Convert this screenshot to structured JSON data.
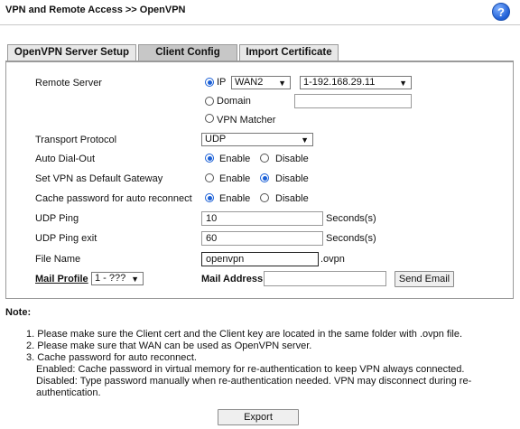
{
  "header": {
    "title": "VPN and Remote Access >> OpenVPN",
    "help_icon": "?"
  },
  "tabs": [
    {
      "label": "OpenVPN Server Setup",
      "active": false
    },
    {
      "label": "Client Config",
      "active": true
    },
    {
      "label": "Import Certificate",
      "active": false
    }
  ],
  "form": {
    "remote_server": {
      "label": "Remote Server",
      "ip_label": "IP",
      "wan_value": "WAN2",
      "ip_value": "1-192.168.29.11",
      "domain_label": "Domain",
      "domain_value": "",
      "vpn_matcher_label": "VPN Matcher"
    },
    "transport_protocol": {
      "label": "Transport Protocol",
      "value": "UDP"
    },
    "auto_dial_out": {
      "label": "Auto Dial-Out",
      "enable": "Enable",
      "disable": "Disable",
      "selected": "Enable"
    },
    "default_gateway": {
      "label": "Set VPN as Default Gateway",
      "enable": "Enable",
      "disable": "Disable",
      "selected": "Disable"
    },
    "cache_password": {
      "label": "Cache password for auto reconnect",
      "enable": "Enable",
      "disable": "Disable",
      "selected": "Enable"
    },
    "udp_ping": {
      "label": "UDP Ping",
      "value": "10",
      "unit": "Seconds(s)"
    },
    "udp_ping_exit": {
      "label": "UDP Ping exit",
      "value": "60",
      "unit": "Seconds(s)"
    },
    "file_name": {
      "label": "File Name",
      "value": "openvpn",
      "ext": ".ovpn"
    },
    "mail_profile": {
      "label": "Mail Profile",
      "value": "1 - ???"
    },
    "mail_address": {
      "label": "Mail Address",
      "value": ""
    },
    "send_email_label": "Send Email"
  },
  "notes": {
    "title": "Note:",
    "lines": [
      "1. Please make sure the Client cert and the Client key are located in the same folder with .ovpn file.",
      "2. Please make sure that WAN can be used as OpenVPN server.",
      "3. Cache password for auto reconnect.",
      "Enabled: Cache password in virtual memory for re-authentication to keep VPN always connected.",
      "Disabled: Type password manually when re-authentication needed. VPN may disconnect during re-",
      "authentication."
    ]
  },
  "export_label": "Export",
  "colors": {
    "radio_accent": "#1a5fd6",
    "tab_active": "#c7c7c7",
    "tab_inactive": "#e8e8e8"
  }
}
